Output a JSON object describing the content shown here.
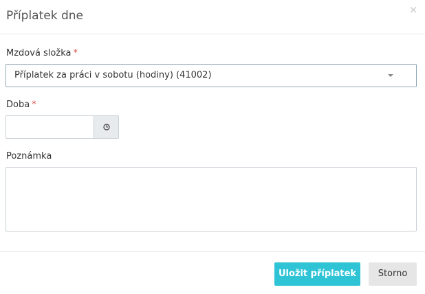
{
  "dialog": {
    "title": "Příplatek dne",
    "close_label": "×"
  },
  "form": {
    "wage_component": {
      "label": "Mzdová složka",
      "required_marker": "*",
      "selected_value": "Příplatek za práci v sobotu (hodiny) (41002)"
    },
    "duration": {
      "label": "Doba",
      "required_marker": "*",
      "value": "",
      "icon": "clock-icon"
    },
    "note": {
      "label": "Poznámka",
      "value": ""
    }
  },
  "footer": {
    "save_label": "Uložit příplatek",
    "cancel_label": "Storno"
  },
  "colors": {
    "primary": "#2ec4d6",
    "required": "#d9534f",
    "cancel_bg": "#e6e6e6"
  }
}
